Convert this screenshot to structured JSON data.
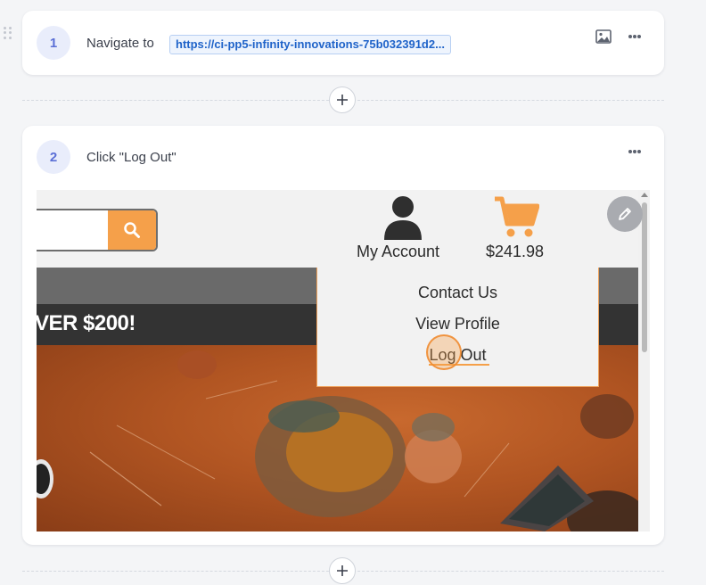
{
  "steps": [
    {
      "number": "1",
      "action": "Navigate to",
      "url": "https://ci-pp5-infinity-innovations-75b032391d2..."
    },
    {
      "number": "2",
      "action": "Click \"Log Out\"",
      "screenshot": {
        "account_label": "My Account",
        "cart_total": "$241.98",
        "promo_text": "VER $200!",
        "dropdown_items": [
          "Contact Us",
          "View Profile",
          "Log Out"
        ]
      }
    }
  ],
  "colors": {
    "accent_orange": "#f5a04a",
    "step_badge_text": "#5b6fd6",
    "url_text": "#1f63c9"
  }
}
